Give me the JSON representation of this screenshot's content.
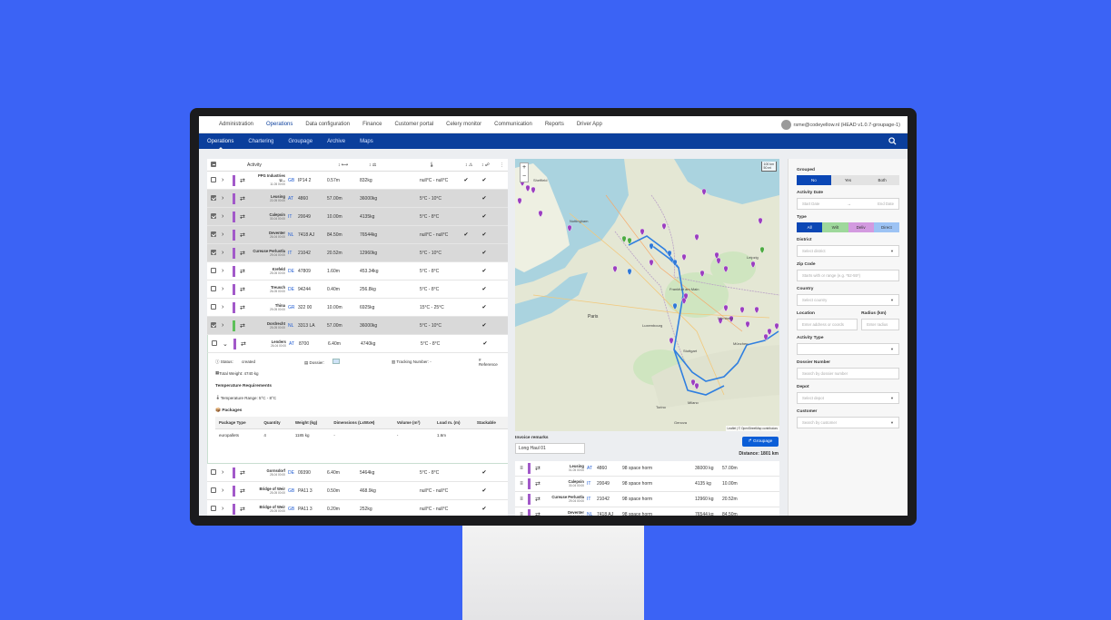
{
  "topnav": {
    "items": [
      "Administration",
      "Operations",
      "Data configuration",
      "Finance",
      "Customer portal",
      "Celery monitor",
      "Communication",
      "Reports",
      "Driver App"
    ],
    "user": "rsme@codeyellow.nl (HEAD v1.0.7-groupage-1)"
  },
  "subnav": {
    "items": [
      "Operations",
      "Chartering",
      "Groupage",
      "Archive",
      "Maps"
    ]
  },
  "table": {
    "header": {
      "activity": "Activity"
    },
    "rows": [
      {
        "name": "PPG Industries U...",
        "date": "11-05 00:00",
        "cc": "GB",
        "zip": "IP14 2",
        "len": "0.57m",
        "wt": "832kg",
        "temp": "null°C - null°C",
        "check1": "✔",
        "check2": "✔",
        "sel": false,
        "bar": "purple"
      },
      {
        "name": "Leusing",
        "date": "22-05 00:00",
        "cc": "AT",
        "zip": "4860",
        "len": "57.00m",
        "wt": "36000kg",
        "temp": "5°C - 10°C",
        "check1": "",
        "check2": "✔",
        "sel": true,
        "bar": "purple"
      },
      {
        "name": "Calepsin",
        "date": "30-04 00:00",
        "cc": "IT",
        "zip": "20049",
        "len": "10.00m",
        "wt": "4135kg",
        "temp": "5°C - 8°C",
        "check1": "",
        "check2": "✔",
        "sel": true,
        "bar": "purple"
      },
      {
        "name": "Deventer",
        "date": "26-04 00:00",
        "cc": "NL",
        "zip": "7418 AJ",
        "len": "84.50m",
        "wt": "76544kg",
        "temp": "null°C - null°C",
        "check1": "✔",
        "check2": "✔",
        "sel": true,
        "bar": "purple"
      },
      {
        "name": "Cureuse Perlustla",
        "date": "29-04 00:00",
        "cc": "IT",
        "zip": "21042",
        "len": "20.52m",
        "wt": "12960kg",
        "temp": "5°C - 10°C",
        "check1": "",
        "check2": "✔",
        "sel": true,
        "bar": "purple"
      },
      {
        "name": "Krefeld",
        "date": "25-05 00:00",
        "cc": "DE",
        "zip": "47809",
        "len": "1.60m",
        "wt": "453.34kg",
        "temp": "5°C - 8°C",
        "check1": "",
        "check2": "✔",
        "sel": false,
        "bar": "purple"
      },
      {
        "name": "Treusch",
        "date": "26-05 00:00",
        "cc": "DE",
        "zip": "94244",
        "len": "0.40m",
        "wt": "256.8kg",
        "temp": "5°C - 8°C",
        "check1": "",
        "check2": "✔",
        "sel": false,
        "bar": "purple"
      },
      {
        "name": "Thina",
        "date": "29-05 00:00",
        "cc": "GR",
        "zip": "322 00",
        "len": "10.00m",
        "wt": "6925kg",
        "temp": "15°C - 25°C",
        "check1": "",
        "check2": "✔",
        "sel": false,
        "bar": "purple"
      },
      {
        "name": "Dordrecht",
        "date": "25-05 00:00",
        "cc": "NL",
        "zip": "3313 LA",
        "len": "57.00m",
        "wt": "36000kg",
        "temp": "5°C - 10°C",
        "check1": "",
        "check2": "✔",
        "sel": true,
        "bar": "green"
      },
      {
        "name": "Lenders",
        "date": "26-04 00:00",
        "cc": "AT",
        "zip": "8700",
        "len": "6.40m",
        "wt": "4740kg",
        "temp": "5°C - 8°C",
        "check1": "",
        "check2": "✔",
        "sel": false,
        "bar": "purple",
        "expanded": true
      }
    ],
    "rows_after": [
      {
        "name": "Gornsdorf",
        "date": "28-04 00:00",
        "cc": "DE",
        "zip": "09390",
        "len": "6.40m",
        "wt": "5464kg",
        "temp": "5°C - 8°C",
        "check1": "",
        "check2": "✔",
        "bar": "purple"
      },
      {
        "name": "Bridge of Weir",
        "date": "25-05 00:00",
        "cc": "GB",
        "zip": "PA11 3",
        "len": "0.50m",
        "wt": "468.9kg",
        "temp": "null°C - null°C",
        "check1": "",
        "check2": "✔",
        "bar": "purple"
      },
      {
        "name": "Bridge of Weir",
        "date": "25-05 00:00",
        "cc": "GB",
        "zip": "PA11 3",
        "len": "0.20m",
        "wt": "252kg",
        "temp": "null°C - null°C",
        "check1": "",
        "check2": "✔",
        "bar": "purple"
      }
    ]
  },
  "detail": {
    "status_label": "Status:",
    "status_value": "created",
    "dossier_label": "Dossier:",
    "tracking_label": "Tracking Number: -",
    "reference_label": "Reference",
    "total_weight": "Total Weight: 4740 kg",
    "temp_section": "Temperature Requirements",
    "temp_range": "Temperature Range: 5°C - 8°C",
    "packages_section": "Packages",
    "pkg_headers": [
      "Package Type",
      "Quantity",
      "Weight (kg)",
      "Dimensions (LxWxH)",
      "Volume (m³)",
      "Load m. (m)",
      "Stackable"
    ],
    "pkg_row": [
      "europallets",
      "4",
      "1185 kg",
      "-",
      "-",
      "1.6m",
      ""
    ]
  },
  "map": {
    "zoom_in": "+",
    "zoom_out": "−",
    "scale_km": "100 km",
    "scale_mi": "50 mi",
    "attribution": "Leaflet | © OpenStreetMap contributors",
    "cities": [
      "Sheffield",
      "Nottingham",
      "Leipzig",
      "Nürnberg",
      "Stuttgart",
      "München",
      "Milano",
      "Torino",
      "Genova",
      "Paris",
      "Luxembourg",
      "Frankfurt am Main"
    ]
  },
  "invoice": {
    "label": "Invoice remarks",
    "value": "Long Haul 01",
    "groupage_btn": "Groupage",
    "distance": "Distance: 1801 km"
  },
  "mlist": [
    {
      "name": "Leusing",
      "date": "01-05 00:00",
      "cc": "AT",
      "zip": "4860",
      "space": "98 space horm",
      "wt": "36000 kg",
      "len": "57.00m"
    },
    {
      "name": "Calepsin",
      "date": "30-04 00:00",
      "cc": "IT",
      "zip": "20049",
      "space": "98 space horm",
      "wt": "4135 kg",
      "len": "10.00m"
    },
    {
      "name": "Cureuse Perlustla",
      "date": "29-04 00:00",
      "cc": "IT",
      "zip": "21042",
      "space": "98 space horm",
      "wt": "12960 kg",
      "len": "20.52m"
    },
    {
      "name": "Deventer",
      "date": "26-04 00:00",
      "cc": "NL",
      "zip": "7418 AJ",
      "space": "98 space horm",
      "wt": "76544 kg",
      "len": "84.50m"
    }
  ],
  "filters": {
    "grouped_label": "Grouped",
    "grouped_opts": [
      "No",
      "Yes",
      "Both"
    ],
    "date_label": "Activity Date",
    "start_ph": "Start Date",
    "end_ph": "End Date",
    "type_label": "Type",
    "type_opts": [
      "All",
      "Wilt",
      "Deliv",
      "Direct"
    ],
    "district_label": "District",
    "district_ph": "Select district",
    "zip_label": "Zip Code",
    "zip_ph": "Starts with or range (e.g. *52-55*)",
    "country_label": "Country",
    "country_ph": "Select country",
    "location_label": "Location",
    "location_ph": "Enter address or coords",
    "radius_label": "Radius (km)",
    "radius_ph": "Enter radius",
    "acttype_label": "Activity Type",
    "dossier_label": "Dossier Number",
    "dossier_ph": "Search by dossier number",
    "depot_label": "Depot",
    "depot_ph": "Select depot",
    "customer_label": "Customer",
    "customer_ph": "Search by customer"
  }
}
